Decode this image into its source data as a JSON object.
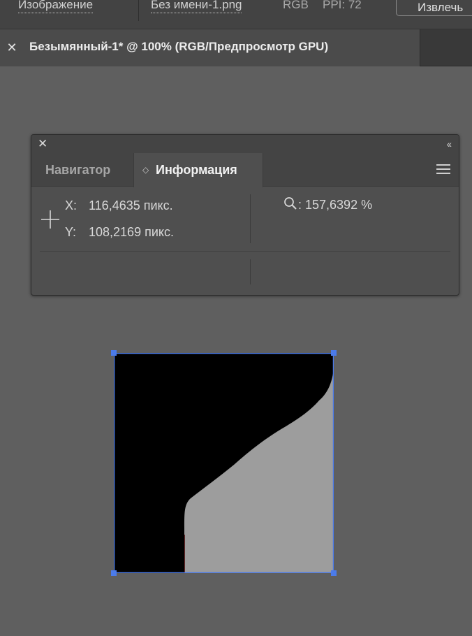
{
  "control_bar": {
    "image_label": "Изображение",
    "filename": "Без имени-1.png",
    "color_mode": "RGB",
    "ppi": "PPI: 72",
    "extract_button": "Извлечь"
  },
  "document_tab": {
    "close_glyph": "✕",
    "title": "Безымянный-1* @ 100% (RGB/Предпросмотр GPU)"
  },
  "info_panel": {
    "close_glyph": "✕",
    "collapse_glyph": "‹‹",
    "tabs": [
      {
        "label": "Навигатор",
        "active": false
      },
      {
        "label": "Информация",
        "active": true
      }
    ],
    "tab_arrow_glyph": "◇",
    "x_key": "X:",
    "x_value": "116,4635 пикс.",
    "y_key": "Y:",
    "y_value": "108,2169 пикс.",
    "zoom_value": ": 157,6392 %"
  },
  "colors": {
    "accent_selection": "#4b7bea",
    "image_dark": "#000000",
    "image_light": "#9d9d9d"
  },
  "icons": [
    "close-icon",
    "collapse-icon",
    "panel-menu-icon",
    "crosshair-icon",
    "zoom-icon",
    "tab-toggle-icon"
  ]
}
